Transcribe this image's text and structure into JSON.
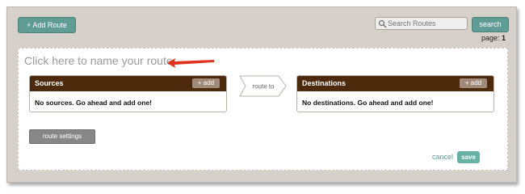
{
  "toolbar": {
    "add_route_label": "+ Add Route",
    "search_placeholder": "Search Routes",
    "search_button_label": "search",
    "page_prefix": "page:",
    "page_number": "1"
  },
  "route": {
    "name_placeholder": "Click here to name your route",
    "connector_label": "route to",
    "settings_label": "route settings",
    "cancel_label": "cancel",
    "save_label": "save"
  },
  "sources": {
    "title": "Sources",
    "add_label": "+ add",
    "empty_message": "No sources. Go ahead and add one!"
  },
  "destinations": {
    "title": "Destinations",
    "add_label": "+ add",
    "empty_message": "No destinations. Go ahead and add one!"
  },
  "colors": {
    "accent": "#5f9c93",
    "box_header": "#4e2a0d",
    "annotation_arrow": "#e0301e"
  },
  "icons": {
    "search": "magnifier-icon",
    "annotation": "red-arrow-icon"
  }
}
